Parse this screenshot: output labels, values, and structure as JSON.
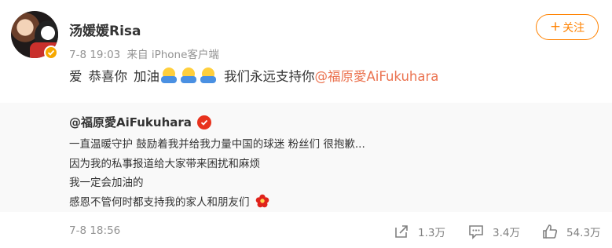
{
  "post": {
    "username": "汤媛媛Risa",
    "time": "7-8 19:03",
    "source": "来自 iPhone客户端",
    "follow_label": "关注",
    "text_segments": [
      "爱",
      "恭喜你",
      "加油"
    ],
    "text_tail": "我们永远支持你",
    "mention": "@福原愛AiFukuhara"
  },
  "repost": {
    "user": "@福原愛AiFukuhara",
    "lines": [
      "一直温暖守护 鼓励着我并给我力量中国的球迷 粉丝们 很抱歉...",
      "因为我的私事报道给大家带来困扰和麻烦",
      "我一定会加油的",
      "感恩不管何时都支持我的家人和朋友们"
    ],
    "time": "7-8 18:56",
    "reposts": "1.3万",
    "comments": "3.4万",
    "likes": "54.3万"
  },
  "icons": {
    "verified": "verified-badge-icon",
    "repost": "repost-icon",
    "comment": "comment-icon",
    "like": "like-icon",
    "flower": "flower-emoji-icon",
    "emoji": "hug-emoji-icon"
  },
  "colors": {
    "accent": "#ff8200",
    "mention": "#eb7350",
    "verified_gold": "#f6a800",
    "verified_red": "#e8321d",
    "meta_gray": "#939393",
    "repost_bg": "#f9f9f9"
  }
}
